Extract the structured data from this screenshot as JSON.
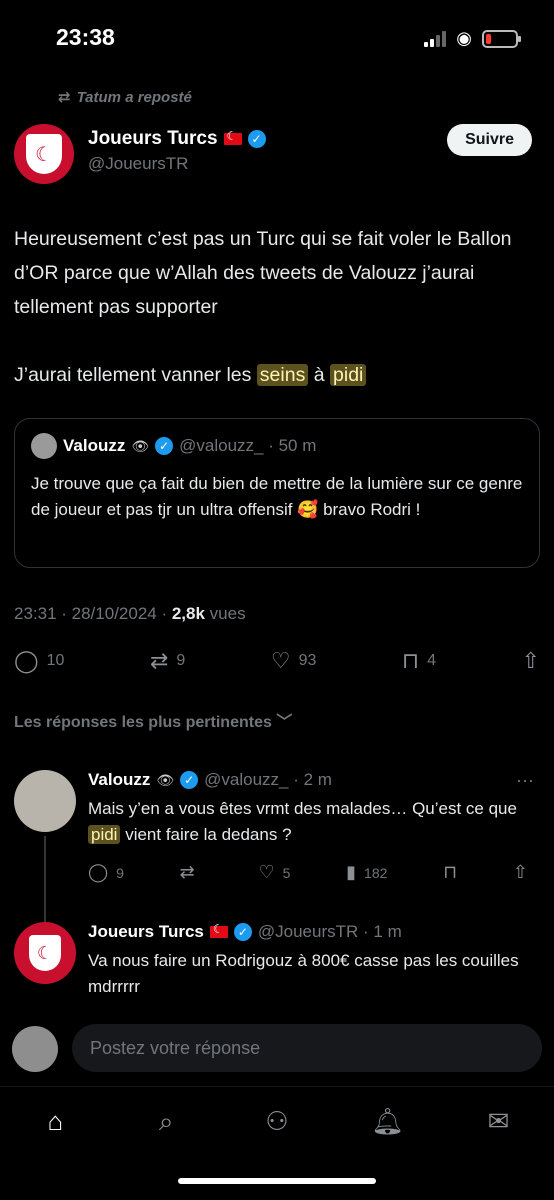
{
  "status_bar": {
    "time": "23:38"
  },
  "repost": {
    "label": "Tatum a reposté"
  },
  "post": {
    "author_name": "Joueurs Turcs",
    "author_handle": "@JoueursTR",
    "follow_label": "Suivre",
    "text_p1": "Heureusement c’est pas un Turc qui se fait voler le Ballon d’OR parce que w’Allah des tweets de Valouzz j’aurai tellement pas supporter",
    "text_p2_before": "J’aurai tellement vanner les ",
    "text_p2_hl1": "seins",
    "text_p2_mid": " à ",
    "text_p2_hl2": "pidi",
    "timestamp": "23:31 · 28/10/2024 · ",
    "views_count": "2,8k",
    "views_label": " vues",
    "replies": "10",
    "reposts": "9",
    "likes": "93",
    "bookmarks": "4"
  },
  "quote": {
    "name": "Valouzz",
    "handle_time": "@valouzz_ · 50 m",
    "text": "Je trouve que ça fait du bien de mettre de la lumière sur ce genre de joueur et pas tjr un ultra offensif 🥰 bravo Rodri !"
  },
  "relevant_label": "Les réponses les plus pertinentes ﹀",
  "replies": [
    {
      "name": "Valouzz",
      "handle_time": "@valouzz_ · 2 m",
      "text_before": "Mais y’en a vous êtes vrmt des malades… Qu’est ce que ",
      "text_hl": "pidi",
      "text_after": " vient faire la dedans ?",
      "replies": "9",
      "reposts": "",
      "likes": "5",
      "views": "182"
    },
    {
      "name": "Joueurs Turcs",
      "handle_time": "@JoueursTR · 1 m",
      "text": "Va nous faire un Rodrigouz à 800€ casse pas les couilles mdrrrrr"
    }
  ],
  "compose": {
    "placeholder": "Postez votre réponse"
  },
  "colors": {
    "accent": "#1d9bf0",
    "highlight": "#5c5220",
    "background": "#000000",
    "brand_red": "#c8102e"
  }
}
